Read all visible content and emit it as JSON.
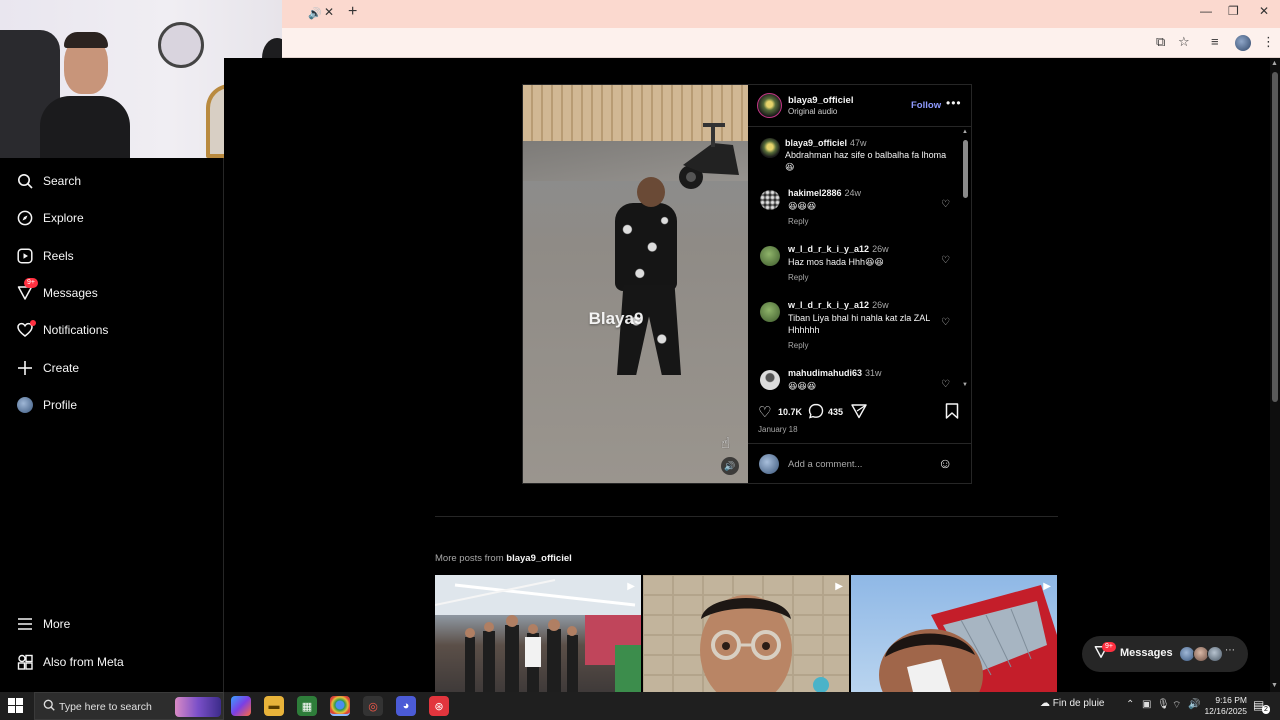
{
  "browser": {
    "tab_speaker": "🔊",
    "tab_close": "✕",
    "new_tab": "+"
  },
  "sidebar": {
    "items": [
      {
        "label": "Search",
        "icon": "search-icon"
      },
      {
        "label": "Explore",
        "icon": "compass-icon"
      },
      {
        "label": "Reels",
        "icon": "reels-icon"
      },
      {
        "label": "Messages",
        "icon": "messenger-icon",
        "badge": "9+"
      },
      {
        "label": "Notifications",
        "icon": "heart-icon"
      },
      {
        "label": "Create",
        "icon": "plus-icon"
      },
      {
        "label": "Profile",
        "icon": "avatar"
      }
    ],
    "bottom_items": [
      {
        "label": "More",
        "icon": "menu-icon"
      },
      {
        "label": "Also from Meta",
        "icon": "meta-apps-icon"
      }
    ]
  },
  "post": {
    "watermark": "Blaya9",
    "author": "blaya9_officiel",
    "subtitle": "Original audio",
    "follow_label": "Follow",
    "likes": "10.7K",
    "comments_count": "435",
    "date": "January 18",
    "comment_placeholder": "Add a comment...",
    "comments": [
      {
        "user": "blaya9_officiel",
        "time": "47w",
        "text": "Abdrahman haz sife o balbalha fa lhoma😆",
        "reply": ""
      },
      {
        "user": "hakimel2886",
        "time": "24w",
        "text": "😆😆😆",
        "reply": "Reply"
      },
      {
        "user": "w_l_d_r_k_i_y_a12",
        "time": "26w",
        "text": "Haz mos hada Hhh😆😆",
        "reply": "Reply"
      },
      {
        "user": "w_l_d_r_k_i_y_a12",
        "time": "26w",
        "text": "Tiban Liya bhal hi nahla kat zla ZAL Hhhhhh",
        "reply": "Reply"
      },
      {
        "user": "mahudimahudi63",
        "time": "31w",
        "text": "😆😆😆",
        "reply": ""
      }
    ]
  },
  "more_posts": {
    "prefix": "More posts from",
    "author": "blaya9_officiel"
  },
  "messages_pill": {
    "label": "Messages",
    "badge": "9+"
  },
  "taskbar": {
    "search_placeholder": "Type here to search",
    "weather": "Fin de pluie",
    "time": "9:16 PM",
    "date": "12/16/2025",
    "notif_count": "2"
  },
  "colors": {
    "accent_follow": "#8f9bff",
    "badge_red": "#ff3040",
    "tabbar": "#fbd9cf"
  }
}
